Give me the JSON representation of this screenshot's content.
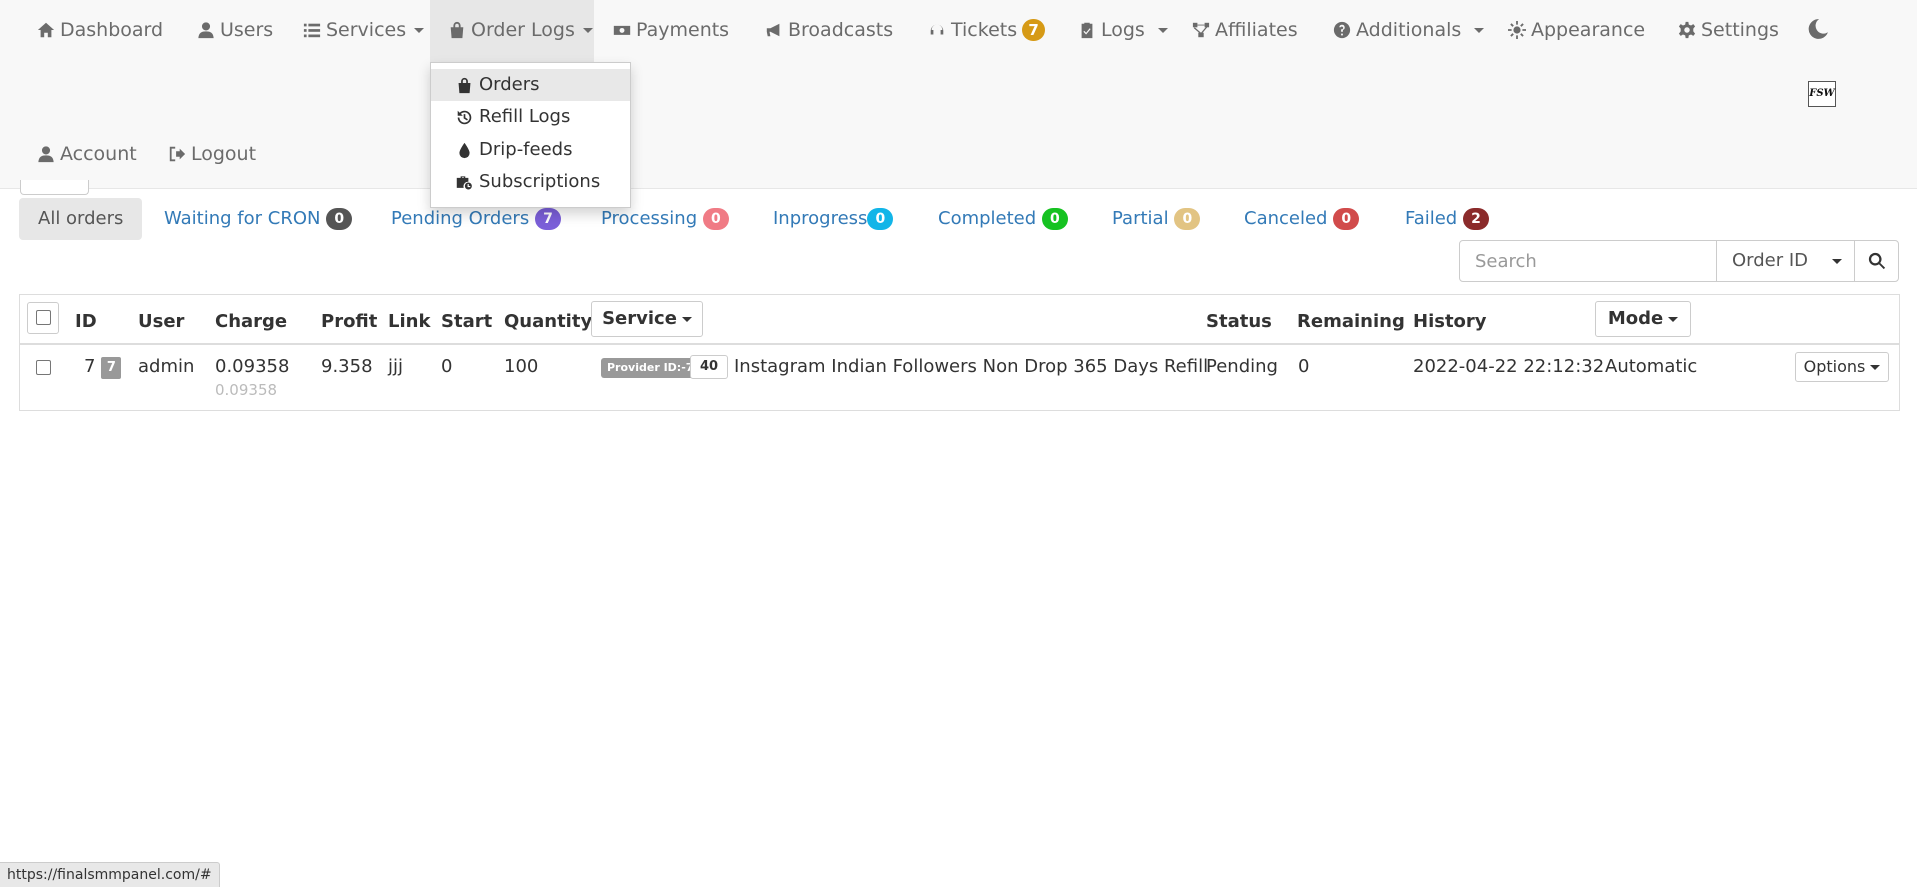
{
  "nav": {
    "dashboard": "Dashboard",
    "users": "Users",
    "services": "Services",
    "order_logs": "Order Logs",
    "payments": "Payments",
    "broadcasts": "Broadcasts",
    "tickets": "Tickets",
    "tickets_count": "7",
    "logs": "Logs",
    "affiliates": "Affiliates",
    "additionals": "Additionals",
    "appearance": "Appearance",
    "settings": "Settings",
    "account": "Account",
    "logout": "Logout",
    "logo_text": "FSW"
  },
  "order_logs_menu": {
    "orders": "Orders",
    "refill_logs": "Refill Logs",
    "drip_feeds": "Drip-feeds",
    "subscriptions": "Subscriptions"
  },
  "tabs": [
    {
      "label": "All orders"
    },
    {
      "label": "Waiting for CRON",
      "count": "0",
      "color": "#555555"
    },
    {
      "label": "Pending Orders",
      "count": "7",
      "color": "#7b5fd9"
    },
    {
      "label": "Processing",
      "count": "0",
      "color": "#f07b85"
    },
    {
      "label": "Inprogress",
      "count": "0",
      "color": "#12b5e8"
    },
    {
      "label": "Completed",
      "count": "0",
      "color": "#16c221"
    },
    {
      "label": "Partial",
      "count": "0",
      "color": "#e2c483"
    },
    {
      "label": "Canceled",
      "count": "0",
      "color": "#d14b4b"
    },
    {
      "label": "Failed",
      "count": "2",
      "color": "#8b2b2b"
    }
  ],
  "search": {
    "placeholder": "Search",
    "field": "Order ID"
  },
  "table": {
    "headers": {
      "id": "ID",
      "user": "User",
      "charge": "Charge",
      "profit": "Profit",
      "link": "Link",
      "start": "Start",
      "quantity": "Quantity",
      "service": "Service",
      "status": "Status",
      "remaining": "Remaining",
      "history": "History",
      "mode": "Mode"
    },
    "rows": [
      {
        "id": "7",
        "id_badge": "7",
        "user": "admin",
        "charge": "0.09358",
        "charge_sub": "0.09358",
        "profit": "9.358",
        "link": "jjj",
        "start": "0",
        "quantity": "100",
        "provider_label": "Provider ID:-7",
        "service_id": "40",
        "service_name": "Instagram Indian Followers Non Drop 365 Days Refill",
        "status": "Pending",
        "remaining": "0",
        "history": "2022-04-22 22:12:32",
        "mode": "Automatic",
        "options": "Options"
      }
    ]
  },
  "status_bar": "https://finalsmmpanel.com/#"
}
